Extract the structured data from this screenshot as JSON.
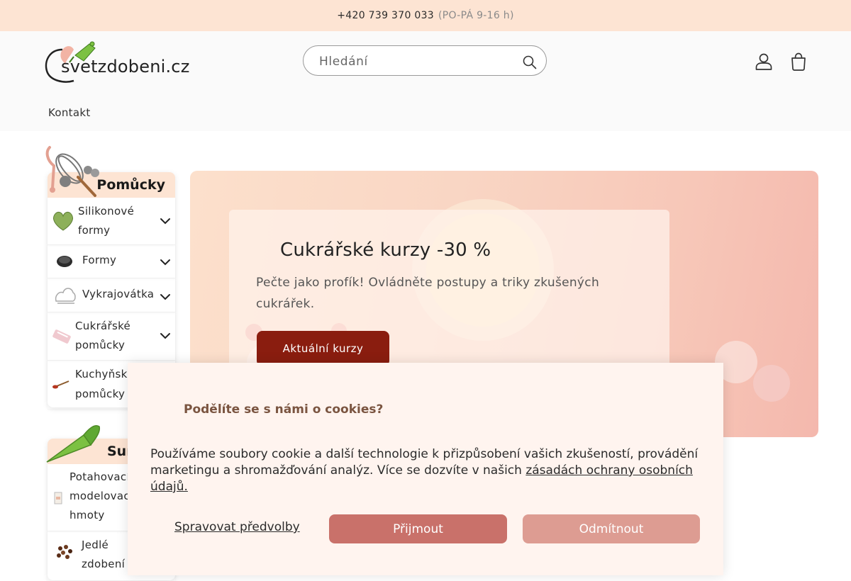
{
  "topbar": {
    "phone": "+420 739 370 033",
    "hours": "(PO-PÁ 9-16 h)"
  },
  "header": {
    "logo_text": "svetzdobeni.cz",
    "search_placeholder": "Hledání",
    "nav": [
      {
        "label": "Kontakt"
      }
    ]
  },
  "sidebar": {
    "sections": [
      {
        "title": "Pomůcky",
        "items": [
          {
            "label_lines": [
              "Silikonové",
              "formy"
            ],
            "has_submenu": true
          },
          {
            "label_lines": [
              "Formy"
            ],
            "has_submenu": true
          },
          {
            "label_lines": [
              "Vykrajovátka"
            ],
            "has_submenu": true
          },
          {
            "label_lines": [
              "Cukrářské",
              "pomůcky"
            ],
            "has_submenu": true
          },
          {
            "label_lines": [
              "Kuchyňské",
              "pomůcky"
            ],
            "has_submenu": true
          }
        ]
      },
      {
        "title": "Suroviny",
        "items": [
          {
            "label_lines": [
              "Potahovací",
              "modelovací",
              "hmoty"
            ]
          },
          {
            "label_lines": [
              "Jedlé",
              "zdobení"
            ]
          }
        ]
      }
    ]
  },
  "hero": {
    "title": "Cukrářské kurzy -30 %",
    "text": "Pečte jako profík! Ovládněte postupy a triky zkušených cukrářek.",
    "button": "Aktuální kurzy"
  },
  "cookie": {
    "title": "Podělíte se s námi o cookies?",
    "text": "Používáme soubory cookie a další technologie k přizpůsobení vašich zkušeností, provádění marketingu a shromažďování analýz. Více se dozvíte v našich ",
    "link": "zásadách ochrany osobních údajů.",
    "manage": "Spravovat předvolby",
    "accept": "Přijmout",
    "reject": "Odmítnout"
  },
  "colors": {
    "topbar_bg": "#fde4d3",
    "accent_dark_red": "#8a1d0f",
    "accept_bg": "#c9716a",
    "reject_bg": "#dd9c92",
    "cookie_bg": "#fff4ef"
  },
  "icons": [
    "search-icon",
    "account-icon",
    "cart-icon",
    "chevron-down-icon",
    "logo-piping-bag-icon",
    "whisk-icon"
  ]
}
